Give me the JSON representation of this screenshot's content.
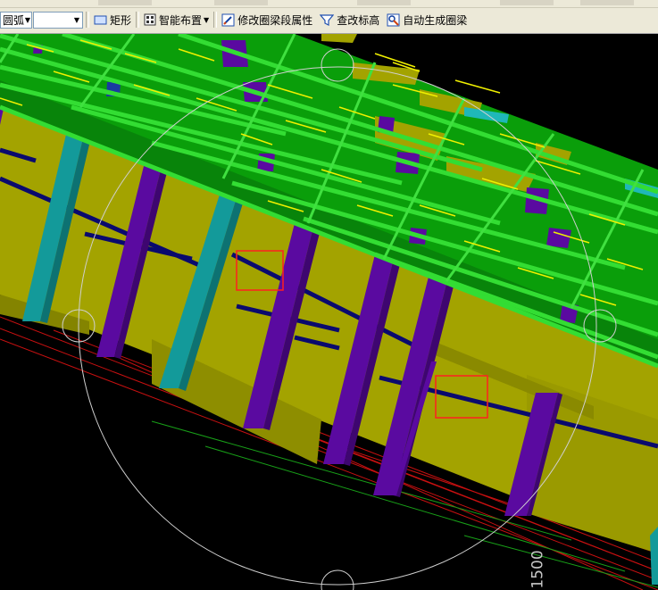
{
  "toolbar": {
    "arc_combo_value": "圆弧",
    "second_combo_value": "",
    "rectangle_label": "矩形",
    "smart_layout_label": "智能布置",
    "edit_segment_label": "修改圈梁段属性",
    "check_elevation_label": "查改标高",
    "auto_generate_label": "自动生成圈梁"
  },
  "viewport": {
    "dimension_label": "1500"
  },
  "colors": {
    "slab": "#0a9e0a",
    "beam": "#33dd33",
    "wall": "#a3a300",
    "column_purple": "#5a0aa0",
    "column_teal": "#139a9a",
    "tie_beam": "#0a0a6e",
    "selection_box": "#ff2020",
    "background": "#000000"
  }
}
